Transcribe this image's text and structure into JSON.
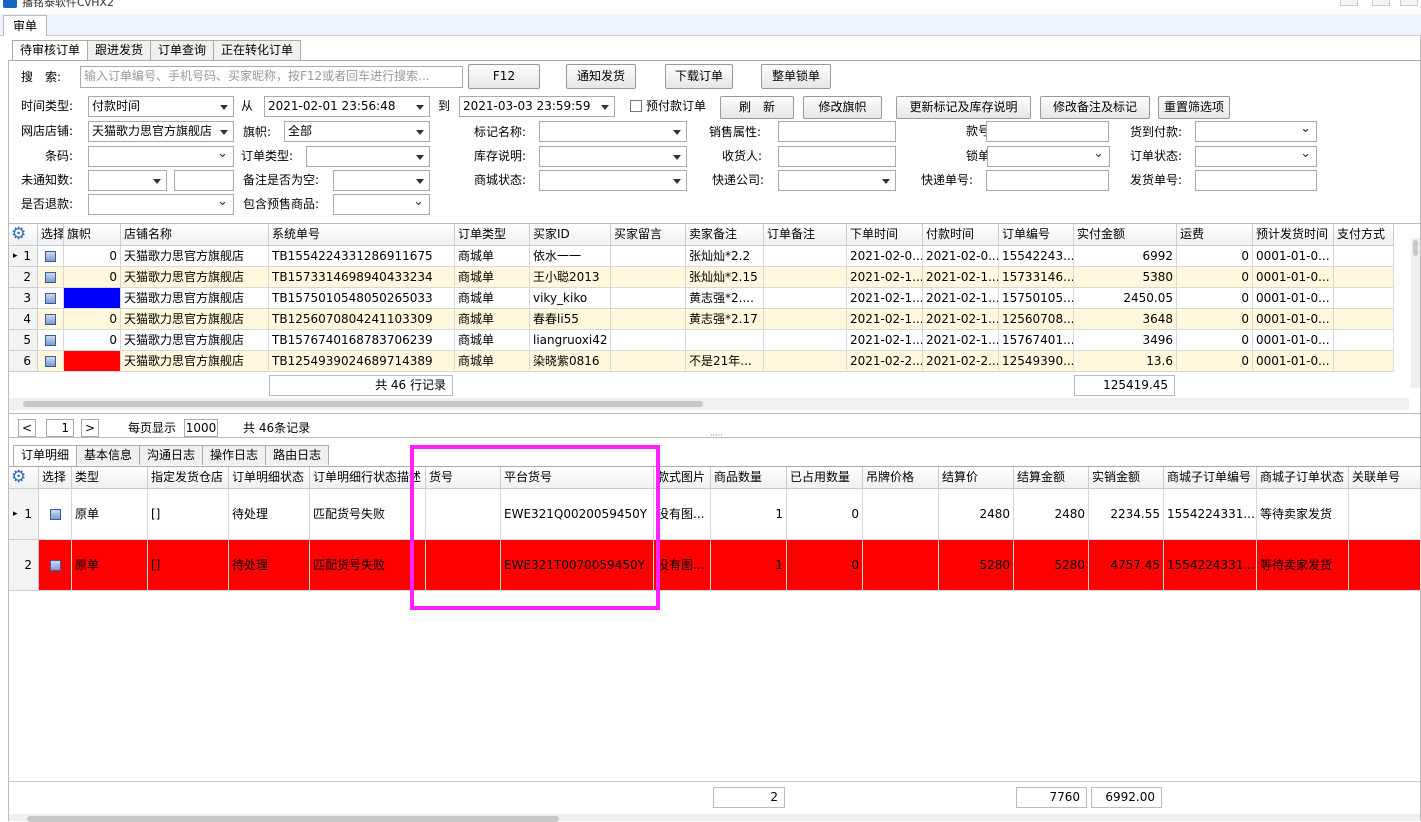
{
  "window": {
    "title": "播铭泰软件CvHX2"
  },
  "menubar": {
    "tab": "审单"
  },
  "tabs_top": [
    "待审核订单",
    "跟进发货",
    "订单查询",
    "正在转化订单"
  ],
  "filters": {
    "search_label": "搜　索:",
    "search_placeholder": "输入订单编号、手机号码、买家昵称，按F12或者回车进行搜索...",
    "btn_f12": "F12",
    "btn_notify": "通知发货",
    "btn_download": "下载订单",
    "btn_lock": "整单锁单",
    "time_type_label": "时间类型:",
    "time_type": "付款时间",
    "from_label": "从",
    "from": "2021-02-01 23:56:48",
    "to_label": "到",
    "to": "2021-03-03 23:59:59",
    "prepay_label": "预付款订单",
    "btn_refresh": "刷　新",
    "btn_flag": "修改旗帜",
    "btn_update_mark": "更新标记及库存说明",
    "btn_modify_note": "修改备注及标记",
    "btn_reset": "重置筛选项",
    "shop_label": "网店店铺:",
    "shop": "天猫歌力思官方旗舰店",
    "flag_label": "旗帜:",
    "flag": "全部",
    "mark_label": "标记名称:",
    "sale_attr_label": "销售属性:",
    "style_no_label": "款号:",
    "arrival_label": "货到付款:",
    "barcode_label": "条码:",
    "order_type_label": "订单类型:",
    "stock_desc_label": "库存说明:",
    "receiver_label": "收货人:",
    "lock_label": "锁单:",
    "order_status_label": "订单状态:",
    "unnotified_label": "未通知数:",
    "note_empty_label": "备注是否为空:",
    "mall_status_label": "商城状态:",
    "courier_label": "快递公司:",
    "courier_no_label": "快递单号:",
    "ship_no_label": "发货单号:",
    "refund_label": "是否退款:",
    "presale_label": "包含预售商品:"
  },
  "grid1": {
    "headers": [
      "选择",
      "旗帜",
      "店铺名称",
      "系统单号",
      "订单类型",
      "买家ID",
      "买家留言",
      "卖家备注",
      "订单备注",
      "下单时间",
      "付款时间",
      "订单编号",
      "实付金额",
      "运费",
      "预计发货时间",
      "支付方式"
    ],
    "rows": [
      {
        "n": "1",
        "flag": "0",
        "flag_color": "",
        "shop": "天猫歌力思官方旗舰店",
        "sys": "TB1554224331286911675",
        "type": "商城单",
        "buyer": "依水一一",
        "msg": "",
        "seller_note": "张灿灿*2.2",
        "order_note": "",
        "order_time": "2021-02-0...",
        "pay_time": "2021-02-0...",
        "order_no": "15542243...",
        "paid": "6992",
        "freight": "0",
        "ship": "0001-01-0...",
        "pay": ""
      },
      {
        "n": "2",
        "flag": "0",
        "flag_color": "",
        "shop": "天猫歌力思官方旗舰店",
        "sys": "TB1573314698940433234",
        "type": "商城单",
        "buyer": "王小聪2013",
        "msg": "",
        "seller_note": "张灿灿*2.15",
        "order_note": "",
        "order_time": "2021-02-1...",
        "pay_time": "2021-02-1...",
        "order_no": "15733146...",
        "paid": "5380",
        "freight": "0",
        "ship": "0001-01-0...",
        "pay": ""
      },
      {
        "n": "3",
        "flag": "",
        "flag_color": "#0000ff",
        "shop": "天猫歌力思官方旗舰店",
        "sys": "TB1575010548050265033",
        "type": "商城单",
        "buyer": "viky_kiko",
        "msg": "",
        "seller_note": "黄志强*2....",
        "order_note": "",
        "order_time": "2021-02-1...",
        "pay_time": "2021-02-1...",
        "order_no": "15750105...",
        "paid": "2450.05",
        "freight": "0",
        "ship": "0001-01-0...",
        "pay": ""
      },
      {
        "n": "4",
        "flag": "0",
        "flag_color": "",
        "shop": "天猫歌力思官方旗舰店",
        "sys": "TB1256070804241103309",
        "type": "商城单",
        "buyer": "春春li55",
        "msg": "",
        "seller_note": "黄志强*2.17",
        "order_note": "",
        "order_time": "2021-02-1...",
        "pay_time": "2021-02-1...",
        "order_no": "12560708...",
        "paid": "3648",
        "freight": "0",
        "ship": "0001-01-0...",
        "pay": ""
      },
      {
        "n": "5",
        "flag": "0",
        "flag_color": "",
        "shop": "天猫歌力思官方旗舰店",
        "sys": "TB1576740168783706239",
        "type": "商城单",
        "buyer": "liangruoxi42",
        "msg": "",
        "seller_note": "",
        "order_note": "",
        "order_time": "2021-02-1...",
        "pay_time": "2021-02-1...",
        "order_no": "15767401...",
        "paid": "3496",
        "freight": "0",
        "ship": "0001-01-0...",
        "pay": ""
      },
      {
        "n": "6",
        "flag": "",
        "flag_color": "#ff0000",
        "shop": "天猫歌力思官方旗舰店",
        "sys": "TB1254939024689714389",
        "type": "商城单",
        "buyer": "染晓紫0816",
        "msg": "",
        "seller_note": "不是21年...",
        "order_note": "",
        "order_time": "2021-02-2...",
        "pay_time": "2021-02-2...",
        "order_no": "12549390...",
        "paid": "13.6",
        "freight": "0",
        "ship": "0001-01-0...",
        "pay": ""
      }
    ],
    "footer_count": "共 46 行记录",
    "footer_total": "125419.45"
  },
  "pager": {
    "prev": "<",
    "page": "1",
    "next": ">",
    "per_page_label": "每页显示",
    "per_page": "1000",
    "total": "共 46条记录"
  },
  "tabs_bottom": [
    "订单明细",
    "基本信息",
    "沟通日志",
    "操作日志",
    "路由日志"
  ],
  "grid2": {
    "headers": [
      "选择",
      "类型",
      "指定发货仓店",
      "订单明细状态",
      "订单明细行状态描述",
      "货号",
      "平台货号",
      "款式图片",
      "商品数量",
      "已占用数量",
      "吊牌价格",
      "结算价",
      "结算金额",
      "实销金额",
      "商城子订单编号",
      "商城子订单状态",
      "关联单号"
    ],
    "rows": [
      {
        "n": "1",
        "type": "原单",
        "wh": "[]",
        "status": "待处理",
        "desc": "匹配货号失败",
        "item_no": "",
        "platform_no": "EWE321Q0020059450Y",
        "img": "没有图...",
        "qty": "1",
        "occupied": "0",
        "tag_price": "",
        "settle_price": "2480",
        "settle_amt": "2480",
        "real_amt": "2234.55",
        "sub_no": "1554224331...",
        "sub_status": "等待卖家发货",
        "rel": ""
      },
      {
        "n": "2",
        "type": "原单",
        "wh": "[]",
        "status": "待处理",
        "desc": "匹配货号失败",
        "item_no": "",
        "platform_no": "EWE321T0070059450Y",
        "img": "没有图...",
        "qty": "1",
        "occupied": "0",
        "tag_price": "",
        "settle_price": "5280",
        "settle_amt": "5280",
        "real_amt": "4757.45",
        "sub_no": "1554224331...",
        "sub_status": "等待卖家发货",
        "rel": ""
      }
    ],
    "footer_qty": "2",
    "footer_settle": "7760",
    "footer_real": "6992.00"
  },
  "colors": {
    "selected_row": "#ff0000",
    "highlight": "#ff22ff",
    "row_alt": "#fff8dc",
    "accent": "#2e6db5"
  }
}
